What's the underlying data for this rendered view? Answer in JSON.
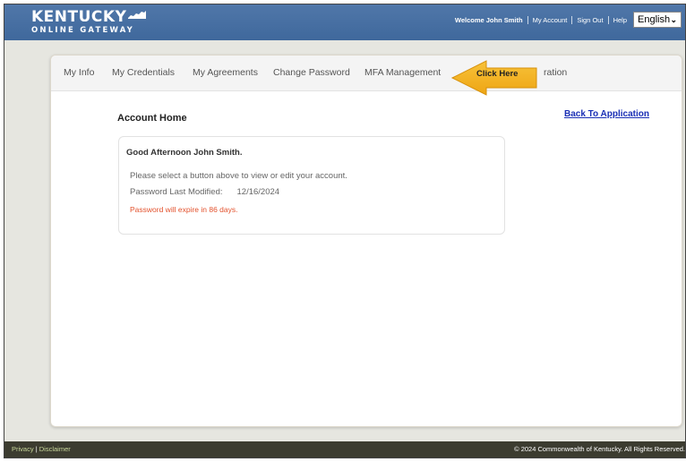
{
  "header": {
    "logo_line1": "KENTUCKY",
    "logo_line2": "ONLINE GATEWAY",
    "welcome": "Welcome John Smith",
    "my_account": "My Account",
    "sign_out": "Sign Out",
    "help": "Help",
    "language": "English"
  },
  "tabs": [
    {
      "label": "My Info"
    },
    {
      "label": "My Credentials"
    },
    {
      "label": "My Agreements"
    },
    {
      "label": "Change Password"
    },
    {
      "label": "MFA Management"
    },
    {
      "label": "ration"
    }
  ],
  "callout": {
    "label": "Click Here",
    "color": "#f5b41c"
  },
  "main": {
    "title": "Account Home",
    "back_link": "Back To Application",
    "greeting": "Good Afternoon John Smith.",
    "instruction": "Please select a button above to view or edit your account.",
    "pw_label": "Password Last Modified:",
    "pw_date": "12/16/2024",
    "expire_notice": "Password will expire in 86 days."
  },
  "footer": {
    "privacy": "Privacy",
    "separator": "|",
    "disclaimer": "Disclaimer",
    "copyright": "© 2024 Commonwealth of Kentucky. All Rights Reserved."
  },
  "colors": {
    "header_blue": "#4a74a8",
    "link_blue": "#1a2fb5",
    "warning_red": "#e3522d",
    "footer_dark": "#3c3c30"
  }
}
